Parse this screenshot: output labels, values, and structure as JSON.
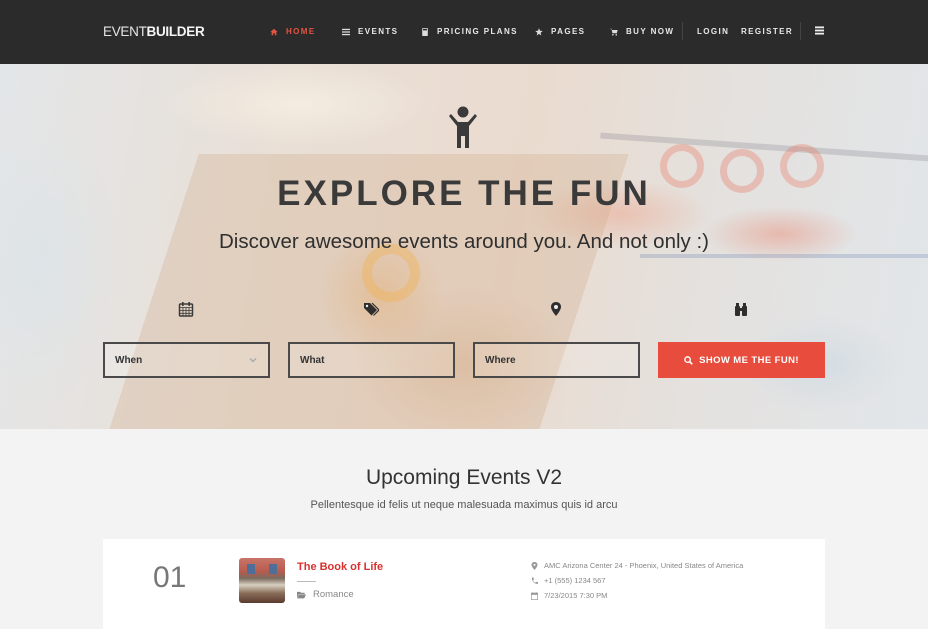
{
  "brand": {
    "logo_thin": "EVENT",
    "logo_bold": "BUILDER"
  },
  "nav": {
    "items": [
      {
        "label": "HOME",
        "icon": "home-icon",
        "active": true
      },
      {
        "label": "EVENTS",
        "icon": "list-icon",
        "active": false
      },
      {
        "label": "PRICING PLANS",
        "icon": "calculator-icon",
        "active": false
      },
      {
        "label": "PAGES",
        "icon": "star-icon",
        "active": false
      },
      {
        "label": "BUY NOW",
        "icon": "cart-icon",
        "active": false
      }
    ],
    "login": "LOGIN",
    "register": "REGISTER",
    "menu_icon": "hamburger-icon",
    "accent_color": "#e25443"
  },
  "hero": {
    "icon": "child-icon",
    "title": "EXPLORE THE FUN",
    "subtitle": "Discover awesome events around you. And not only :)",
    "fields": [
      {
        "icon": "calendar-icon",
        "placeholder": "When",
        "type": "select"
      },
      {
        "icon": "tags-icon",
        "placeholder": "What",
        "type": "text"
      },
      {
        "icon": "map-marker-icon",
        "placeholder": "Where",
        "type": "text"
      }
    ],
    "button_icon": "binoculars-icon",
    "button_label": "SHOW ME THE FUN!",
    "button_color": "#e74c3c"
  },
  "upcoming": {
    "title": "Upcoming Events V2",
    "subtitle": "Pellentesque id felis ut neque malesuada maximus quis id arcu",
    "events": [
      {
        "number": "01",
        "title": "The Book of Life",
        "category": "Romance",
        "location": "AMC Arizona Center 24 - Phoenix, United States of America",
        "phone": "+1 (555) 1234 567",
        "datetime": "7/23/2015 7:30 PM"
      }
    ]
  }
}
